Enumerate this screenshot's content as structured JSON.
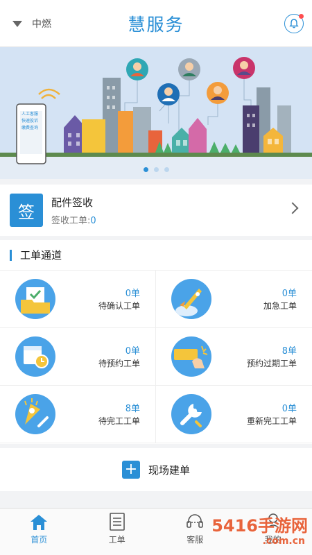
{
  "header": {
    "location": "中燃",
    "title": "慧服务"
  },
  "banner": {
    "phone_lines": [
      "人工客服",
      "快速投诉",
      "缴费查询"
    ],
    "active_slide": 1,
    "slide_count": 3
  },
  "signin": {
    "icon_char": "签",
    "title": "配件签收",
    "sub_label": "签收工单:",
    "sub_count": "0"
  },
  "channel": {
    "title": "工单通道",
    "items": [
      {
        "count": "0单",
        "label": "待确认工单",
        "icon": "folder-check-icon"
      },
      {
        "count": "0单",
        "label": "加急工单",
        "icon": "rocket-icon"
      },
      {
        "count": "0单",
        "label": "待预约工单",
        "icon": "calendar-clock-icon"
      },
      {
        "count": "8单",
        "label": "预约过期工单",
        "icon": "expired-card-icon"
      },
      {
        "count": "8单",
        "label": "待完工工单",
        "icon": "tools-icon"
      },
      {
        "count": "0单",
        "label": "重新完工工单",
        "icon": "wrench-icon"
      }
    ]
  },
  "create": {
    "label": "现场建单"
  },
  "tabbar": {
    "items": [
      {
        "label": "首页",
        "icon": "home-icon",
        "active": true
      },
      {
        "label": "工单",
        "icon": "list-icon",
        "active": false
      },
      {
        "label": "客服",
        "icon": "headset-icon",
        "active": false
      },
      {
        "label": "我的",
        "icon": "user-icon",
        "active": false
      }
    ]
  },
  "watermark": {
    "line1": "5416手游网",
    "line2": ".com.cn"
  },
  "colors": {
    "accent": "#2a8fd6",
    "badge": "#ff4d4f"
  }
}
